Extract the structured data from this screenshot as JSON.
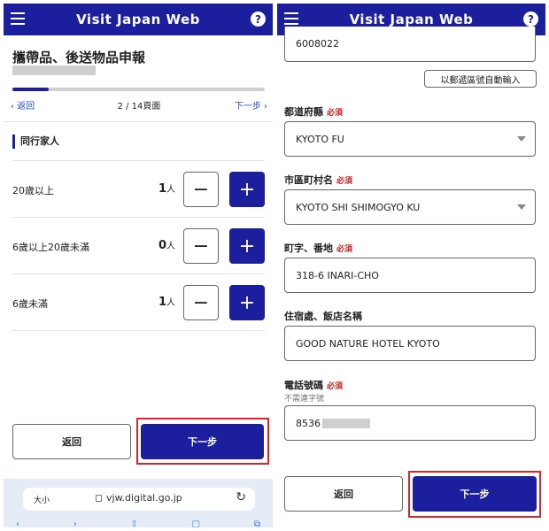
{
  "app": {
    "title": "Visit Japan Web",
    "help_glyph": "?"
  },
  "left": {
    "page_title": "攜帶品、後送物品申報",
    "progress": {
      "current": 2,
      "total": 14,
      "fraction": 0.143,
      "prev_label": "返回",
      "count_label": "2 / 14頁面",
      "next_label": "下一步"
    },
    "section_title": "同行家人",
    "rows": [
      {
        "label": "20歲以上",
        "count": "1",
        "unit": "人"
      },
      {
        "label": "6歲以上20歲未滿",
        "count": "0",
        "unit": "人"
      },
      {
        "label": "6歲未滿",
        "count": "1",
        "unit": "人"
      }
    ],
    "footer": {
      "back_label": "返回",
      "next_label": "下一步"
    },
    "browser": {
      "text_size": "大小",
      "url": "vjw.digital.go.jp"
    }
  },
  "right": {
    "postal_value": "6008022",
    "zip_button": "以郵遞區號自動輸入",
    "required_mark": "必須",
    "prefecture": {
      "label": "都道府縣",
      "value": "KYOTO FU"
    },
    "city": {
      "label": "市區町村名",
      "value": "KYOTO SHI SHIMOGYO KU"
    },
    "street": {
      "label": "町字、番地",
      "value": "318-6 INARI-CHO"
    },
    "hotel": {
      "label": "住宿處、飯店名稱",
      "value": "GOOD NATURE HOTEL KYOTO"
    },
    "phone": {
      "label": "電話號碼",
      "hint": "不需連字號",
      "value": "8536"
    },
    "footer": {
      "back_label": "返回",
      "next_label": "下一步"
    }
  },
  "colors": {
    "brand": "#1b1f9e",
    "highlight": "#d9262b",
    "required": "#c8201e"
  }
}
